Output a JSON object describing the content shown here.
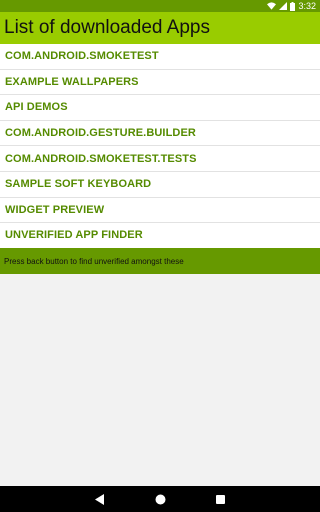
{
  "status_bar": {
    "time": "3:32",
    "icons": [
      "wifi-icon",
      "signal-icon",
      "battery-icon"
    ]
  },
  "app_bar": {
    "title": "List of downloaded Apps"
  },
  "apps": [
    "COM.ANDROID.SMOKETEST",
    "EXAMPLE WALLPAPERS",
    "API DEMOS",
    "COM.ANDROID.GESTURE.BUILDER",
    "COM.ANDROID.SMOKETEST.TESTS",
    "SAMPLE SOFT KEYBOARD",
    "WIDGET PREVIEW",
    "UNVERIFIED APP FINDER"
  ],
  "info": {
    "text": "Press back button to find unverified amongst these"
  },
  "nav_bar": {
    "buttons": [
      "back-icon",
      "home-icon",
      "recents-icon"
    ]
  },
  "colors": {
    "status_bar": "#669900",
    "app_bar": "#99cc00",
    "list_text": "#558b00",
    "info_bar": "#669900"
  }
}
